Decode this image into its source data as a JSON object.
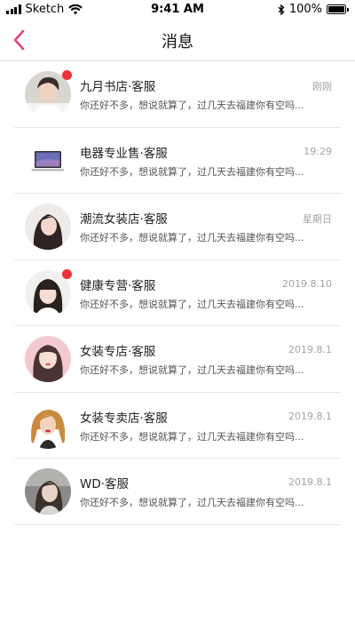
{
  "status_bar": {
    "carrier": "Sketch",
    "time": "9:41 AM",
    "battery": "100%",
    "battery_level": 1.0
  },
  "header": {
    "title": "消息",
    "back_icon": "chevron-left-icon",
    "accent_color": "#e0457b"
  },
  "conversations": [
    {
      "name": "九月书店·客服",
      "time": "刚刚",
      "preview": "你还好不多，想说就算了，过几天去福建你有空吗...",
      "unread": true,
      "avatar": "young man in white shirt"
    },
    {
      "name": "电器专业售·客服",
      "time": "19:29",
      "preview": "你还好不多，想说就算了，过几天去福建你有空吗...",
      "unread": false,
      "avatar": "laptop"
    },
    {
      "name": "潮流女装店·客服",
      "time": "星期日",
      "preview": "你还好不多，想说就算了，过几天去福建你有空吗...",
      "unread": false,
      "avatar": "woman with long dark hair"
    },
    {
      "name": "健康专营·客服",
      "time": "2019.8.10",
      "preview": "你还好不多，想说就算了，过几天去福建你有空吗...",
      "unread": true,
      "avatar": "woman with bangs"
    },
    {
      "name": "女装专店·客服",
      "time": "2019.8.1",
      "preview": "你还好不多，想说就算了，过几天去福建你有空吗...",
      "unread": false,
      "avatar": "woman on pink background"
    },
    {
      "name": "女装专卖店·客服",
      "time": "2019.8.1",
      "preview": "你还好不多，想说就算了，过几天去福建你有空吗...",
      "unread": false,
      "avatar": "woman with curly blonde hair"
    },
    {
      "name": "WD·客服",
      "time": "2019.8.1",
      "preview": "你还好不多，想说就算了，过几天去福建你有空吗...",
      "unread": false,
      "avatar": "woman in grey outdoor photo"
    }
  ]
}
